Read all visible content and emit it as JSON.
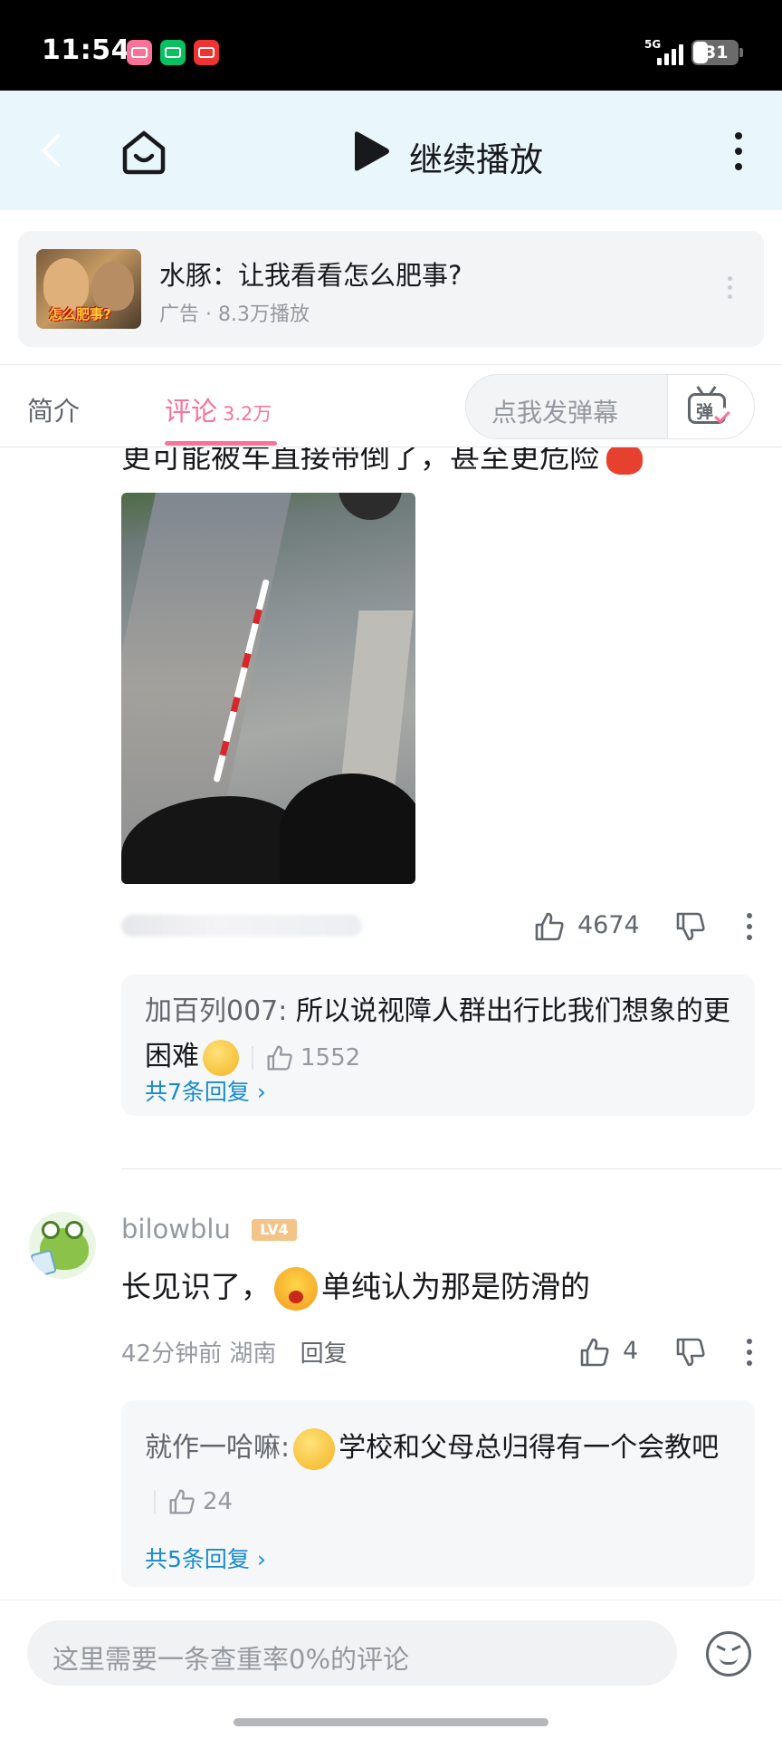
{
  "status_bar": {
    "time": "11:54",
    "network": "5G",
    "battery": "31"
  },
  "top_bar": {
    "continue_label": "继续播放"
  },
  "ad": {
    "title": "水豚：让我看看怎么肥事?",
    "meta": "广告 · 8.3万播放",
    "thumb_text": "怎么肥事?"
  },
  "tabs": {
    "intro": "简介",
    "comments": "评论",
    "comments_count": "3.2万"
  },
  "danmaku": {
    "placeholder": "点我发弹幕",
    "icon_char": "弹"
  },
  "comment1": {
    "partial_text": "更可能被车直接带倒了，甚至更危险",
    "likes": "4674",
    "reply": {
      "author": "加百列007:",
      "text": " 所以说视障人群出行比我们想象的更困难",
      "likes": "1552",
      "more": "共7条回复"
    }
  },
  "comment2": {
    "username": "bilowblu",
    "level": "LV4",
    "text_before": "长见识了，",
    "text_after": "单纯认为那是防滑的",
    "time": "42分钟前",
    "location": "湖南",
    "reply_label": "回复",
    "likes": "4",
    "reply": {
      "author": "就作一哈嘛:",
      "text": "学校和父母总归得有一个会教吧",
      "likes": "24",
      "more": "共5条回复"
    }
  },
  "input": {
    "placeholder": "这里需要一条查重率0%的评论"
  },
  "colors": {
    "accent": "#fb7299",
    "link": "#178bcf",
    "header_bg": "#e9f6fb"
  }
}
